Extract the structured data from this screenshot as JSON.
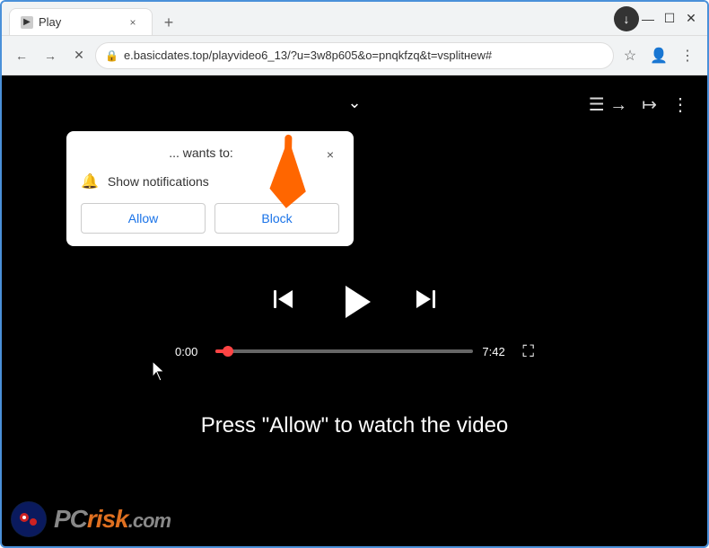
{
  "browser": {
    "tab": {
      "favicon": "▶",
      "title": "Play",
      "close_label": "×"
    },
    "new_tab_label": "+",
    "window_controls": {
      "minimize": "—",
      "maximize": "☐",
      "close": "✕"
    },
    "nav": {
      "back_label": "←",
      "forward_label": "→",
      "reload_label": "✕",
      "address": "e.basicdates.top/playvideo6_13/?u=3w8p605&o=pnqkfzq&t=vsplitнew#",
      "lock_icon": "🔒",
      "star_icon": "☆",
      "profile_icon": "👤",
      "menu_icon": "⋮",
      "download_icon": "↓"
    }
  },
  "notification_popup": {
    "title": "... wants to:",
    "close_label": "×",
    "notification_label": "Show notifications",
    "allow_label": "Allow",
    "block_label": "Block"
  },
  "video_player": {
    "current_time": "0:00",
    "total_time": "7:42",
    "press_text": "Press \"Allow\" to watch the video",
    "chevron": "⌄",
    "queue_icon": "≡",
    "share_icon": "↗",
    "more_icon": "⋮"
  },
  "watermark": {
    "pc_text": "PC",
    "risk_text": "risk",
    "com_text": ".com"
  }
}
